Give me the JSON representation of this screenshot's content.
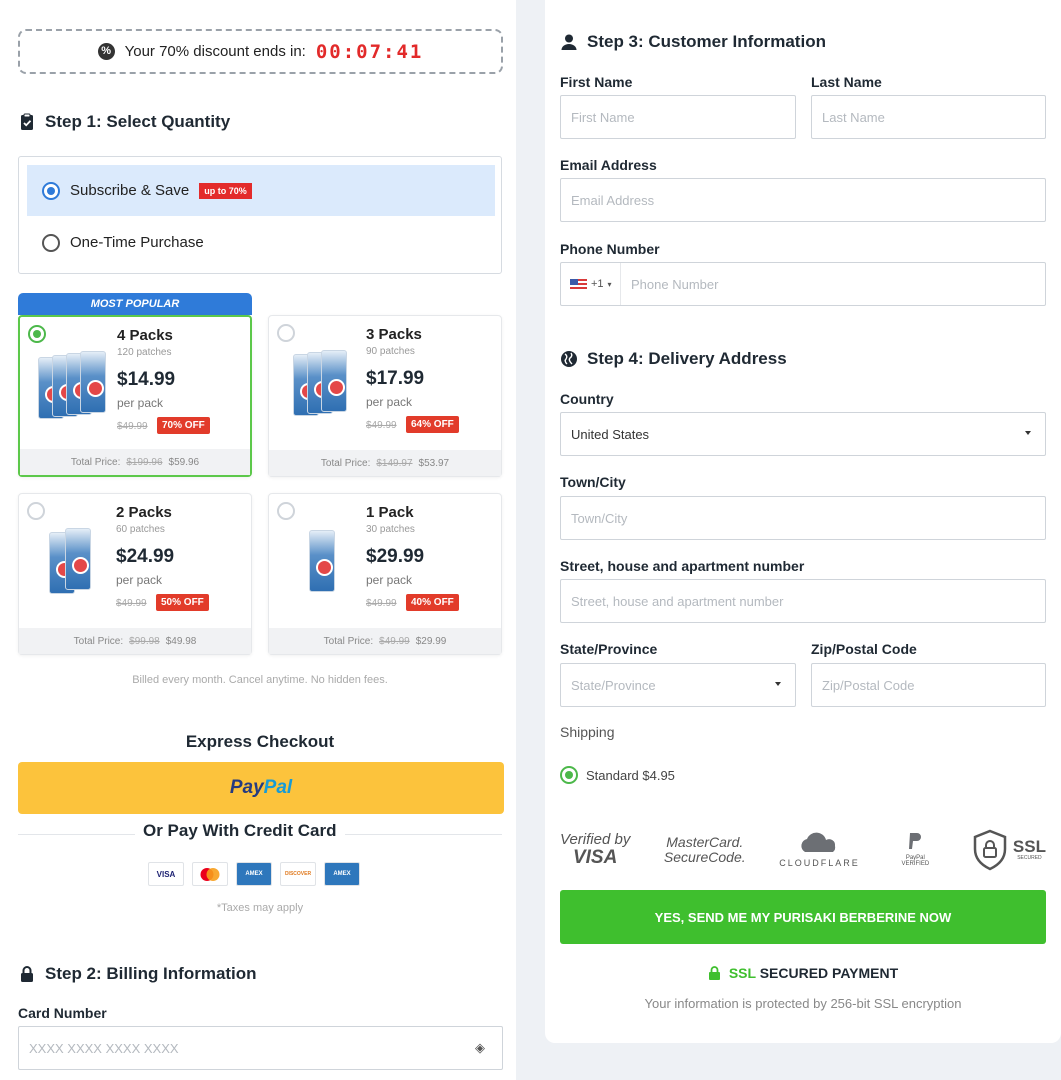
{
  "timer": {
    "label": "Your 70% discount ends in:",
    "value": "00:07:41"
  },
  "step1": {
    "title": "Step 1: Select Quantity",
    "subscribe_label": "Subscribe & Save",
    "subscribe_badge": "up to 70%",
    "onetime_label": "One-Time Purchase",
    "popular_tag": "MOST POPULAR",
    "packs": [
      {
        "title": "4 Packs",
        "sub": "120 patches",
        "price": "$14.99",
        "per": "per pack",
        "old": "$49.99",
        "off": "70% OFF",
        "total_label": "Total Price:",
        "total_old": "$199.96",
        "total_new": "$59.96",
        "selected": true
      },
      {
        "title": "3 Packs",
        "sub": "90 patches",
        "price": "$17.99",
        "per": "per pack",
        "old": "$49.99",
        "off": "64% OFF",
        "total_label": "Total Price:",
        "total_old": "$149.97",
        "total_new": "$53.97",
        "selected": false
      },
      {
        "title": "2 Packs",
        "sub": "60 patches",
        "price": "$24.99",
        "per": "per pack",
        "old": "$49.99",
        "off": "50% OFF",
        "total_label": "Total Price:",
        "total_old": "$99.98",
        "total_new": "$49.98",
        "selected": false
      },
      {
        "title": "1 Pack",
        "sub": "30 patches",
        "price": "$29.99",
        "per": "per pack",
        "old": "$49.99",
        "off": "40% OFF",
        "total_label": "Total Price:",
        "total_old": "$49.99",
        "total_new": "$29.99",
        "selected": false
      }
    ],
    "billing_note": "Billed every month. Cancel anytime. No hidden fees."
  },
  "express": {
    "title": "Express Checkout",
    "paypal_a": "Pay",
    "paypal_b": "Pal",
    "or_credit": "Or Pay With Credit Card",
    "cards": [
      "VISA",
      "MC",
      "AMEX",
      "DISCOVER",
      "AMEX"
    ],
    "taxes": "*Taxes may apply"
  },
  "step2": {
    "title": "Step 2: Billing Information",
    "card_label": "Card Number",
    "card_placeholder": "XXXX XXXX XXXX XXXX"
  },
  "step3": {
    "title": "Step 3: Customer Information",
    "first_label": "First Name",
    "first_placeholder": "First Name",
    "last_label": "Last Name",
    "last_placeholder": "Last Name",
    "email_label": "Email Address",
    "email_placeholder": "Email Address",
    "phone_label": "Phone Number",
    "phone_code": "+1",
    "phone_placeholder": "Phone Number"
  },
  "step4": {
    "title": "Step 4: Delivery Address",
    "country_label": "Country",
    "country_value": "United States",
    "city_label": "Town/City",
    "city_placeholder": "Town/City",
    "street_label": "Street, house and apartment number",
    "street_placeholder": "Street, house and apartment number",
    "state_label": "State/Province",
    "state_placeholder": "State/Province",
    "zip_label": "Zip/Postal Code",
    "zip_placeholder": "Zip/Postal Code",
    "shipping_label": "Shipping",
    "shipping_option": "Standard $4.95"
  },
  "trust": {
    "verified_a": "Verified by",
    "verified_b": "VISA",
    "mc_a": "MasterCard.",
    "mc_b": "SecureCode.",
    "cloudflare": "CLOUDFLARE",
    "paypal_verified": "PayPal VERIFIED",
    "ssl": "SSL",
    "ssl_sub": "SECURED"
  },
  "submit": {
    "label": "YES, SEND ME MY PURISAKI BERBERINE NOW",
    "ssl_green": "SSL",
    "ssl_text": "SECURED PAYMENT",
    "ssl_sub": "Your information is protected by 256-bit SSL encryption"
  }
}
